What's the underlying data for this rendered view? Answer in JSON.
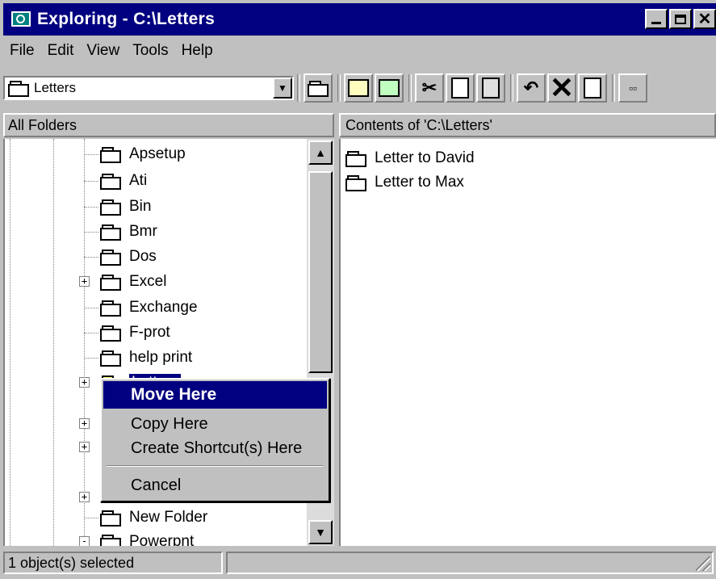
{
  "window": {
    "title": "Exploring - C:\\Letters",
    "buttons": [
      "minimize",
      "maximize",
      "close"
    ]
  },
  "menubar": {
    "items": [
      "File",
      "Edit",
      "View",
      "Tools",
      "Help"
    ]
  },
  "toolbar": {
    "address_value": "Letters",
    "buttons": [
      "up-one-level-icon",
      "map-drive-icon",
      "disconnect-icon",
      "cut-icon",
      "copy-icon",
      "paste-icon",
      "undo-icon",
      "delete-icon",
      "properties-icon",
      "large-icons-icon"
    ]
  },
  "left_header": "All Folders",
  "right_header": "Contents of 'C:\\Letters'",
  "tree": {
    "items": [
      {
        "label": "Apsetup",
        "expander": ""
      },
      {
        "label": "Ati",
        "expander": ""
      },
      {
        "label": "Bin",
        "expander": ""
      },
      {
        "label": "Bmr",
        "expander": ""
      },
      {
        "label": "Dos",
        "expander": ""
      },
      {
        "label": "Excel",
        "expander": "+"
      },
      {
        "label": "Exchange",
        "expander": ""
      },
      {
        "label": "F-prot",
        "expander": ""
      },
      {
        "label": "help print",
        "expander": ""
      },
      {
        "label": "Letters",
        "expander": "+",
        "selected": true
      },
      {
        "label": "New Folder",
        "expander": ""
      },
      {
        "label": "Powerpnt",
        "expander": "-"
      }
    ]
  },
  "contents": {
    "items": [
      {
        "label": "Letter to David",
        "icon": "folder-open-icon"
      },
      {
        "label": "Letter to Max",
        "icon": "folder-icon"
      }
    ]
  },
  "context_menu": {
    "items": [
      {
        "label": "Move Here",
        "highlighted": true
      },
      {
        "label": "Copy Here"
      },
      {
        "label": "Create Shortcut(s) Here"
      },
      {
        "label": "Cancel"
      }
    ]
  },
  "status": {
    "text": "1 object(s) selected"
  },
  "colors": {
    "title_bar": "#000080",
    "face": "#c0c0c0",
    "selection": "#000080"
  }
}
